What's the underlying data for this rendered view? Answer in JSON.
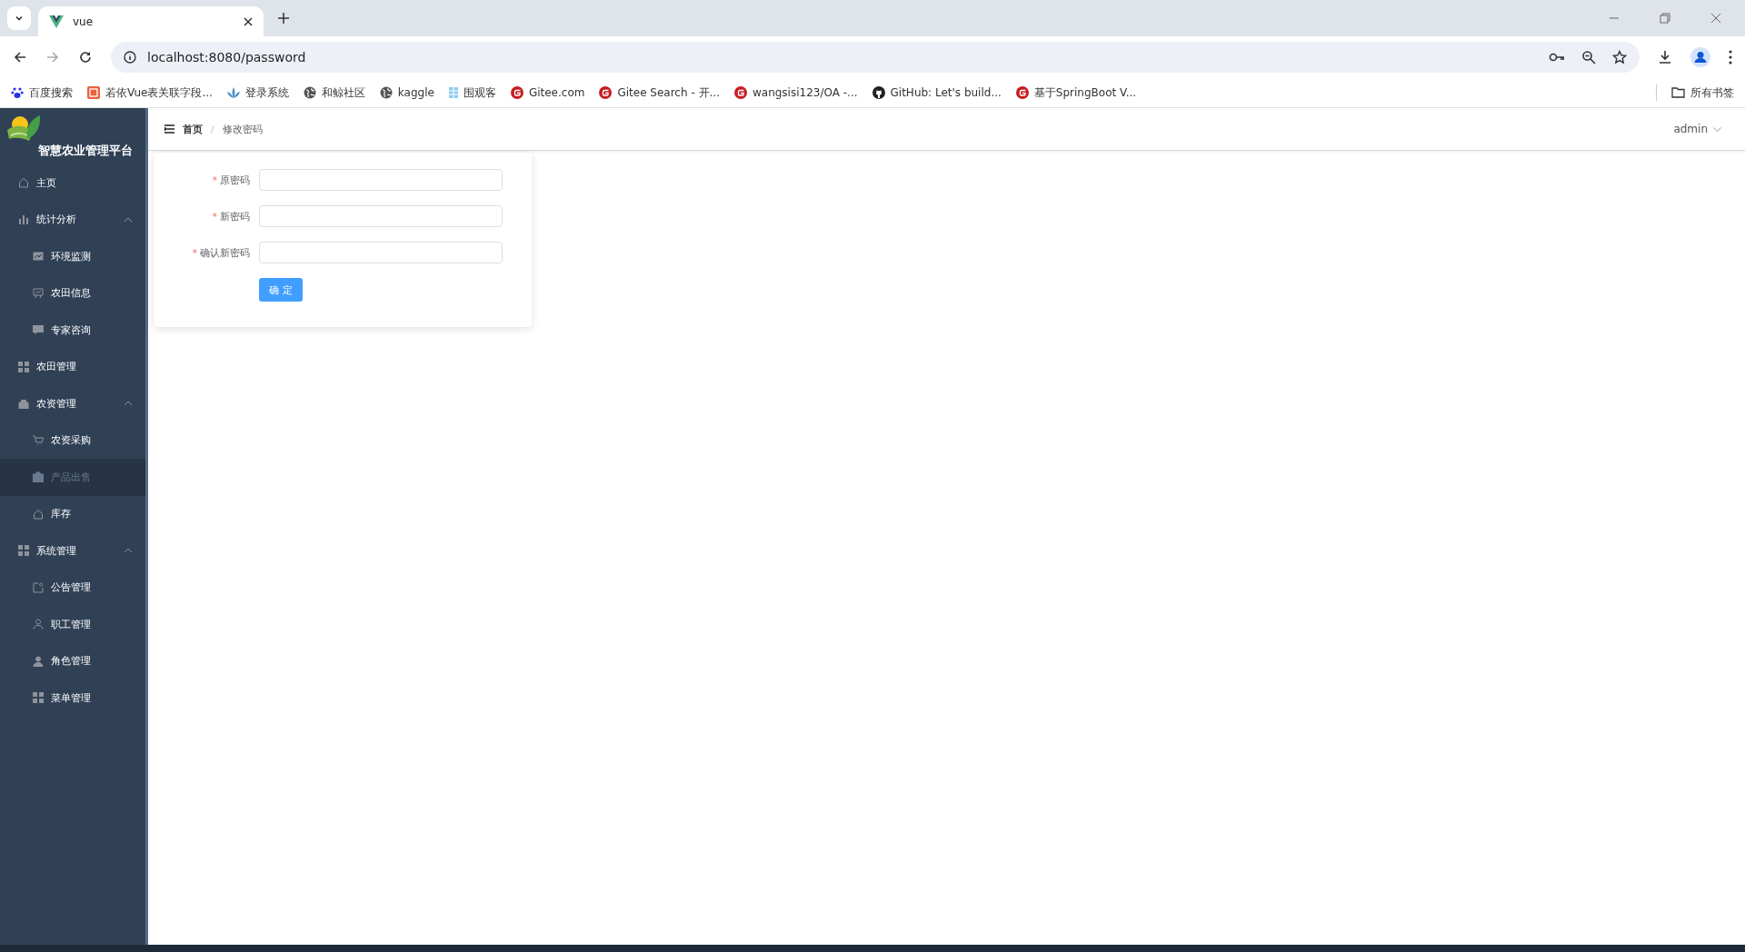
{
  "browser": {
    "tab": {
      "title": "vue"
    },
    "address": "localhost:8080/password",
    "bookmarks": [
      {
        "kind": "paw",
        "label": "百度搜索"
      },
      {
        "kind": "badge",
        "label": "若依Vue表关联字段..."
      },
      {
        "kind": "leaf",
        "label": "登录系统"
      },
      {
        "kind": "globe",
        "label": "和鲸社区"
      },
      {
        "kind": "globe",
        "label": "kaggle"
      },
      {
        "kind": "tile",
        "label": "围观客"
      },
      {
        "kind": "gitee",
        "label": "Gitee.com"
      },
      {
        "kind": "gitee",
        "label": "Gitee Search - 开..."
      },
      {
        "kind": "gitee",
        "label": "wangsisi123/OA -..."
      },
      {
        "kind": "github",
        "label": "GitHub: Let's build..."
      },
      {
        "kind": "gitee",
        "label": "基于SpringBoot V..."
      }
    ],
    "all_bookmarks": "所有书签"
  },
  "sidebar": {
    "title": "智慧农业管理平台",
    "items": [
      {
        "label": "主页",
        "selected": false
      },
      {
        "label": "统计分析",
        "expanded": true,
        "children": [
          {
            "label": "环境监测",
            "selected": false
          },
          {
            "label": "农田信息",
            "selected": false
          },
          {
            "label": "专家咨询",
            "selected": false
          }
        ]
      },
      {
        "label": "农田管理",
        "selected": false
      },
      {
        "label": "农资管理",
        "expanded": true,
        "children": [
          {
            "label": "农资采购",
            "selected": false
          },
          {
            "label": "产品出售",
            "selected": true
          },
          {
            "label": "库存",
            "selected": false
          }
        ]
      },
      {
        "label": "系统管理",
        "expanded": true,
        "children": [
          {
            "label": "公告管理",
            "selected": false
          },
          {
            "label": "职工管理",
            "selected": false
          },
          {
            "label": "角色管理",
            "selected": false
          },
          {
            "label": "菜单管理",
            "selected": false
          }
        ]
      }
    ]
  },
  "header": {
    "breadcrumb": [
      "首页",
      "修改密码"
    ],
    "separator": "/",
    "user": "admin"
  },
  "form": {
    "fields": [
      {
        "label": "原密码",
        "required": true
      },
      {
        "label": "新密码",
        "required": true
      },
      {
        "label": "确认新密码",
        "required": true
      }
    ],
    "submit": "确 定",
    "required_mark": "*"
  }
}
